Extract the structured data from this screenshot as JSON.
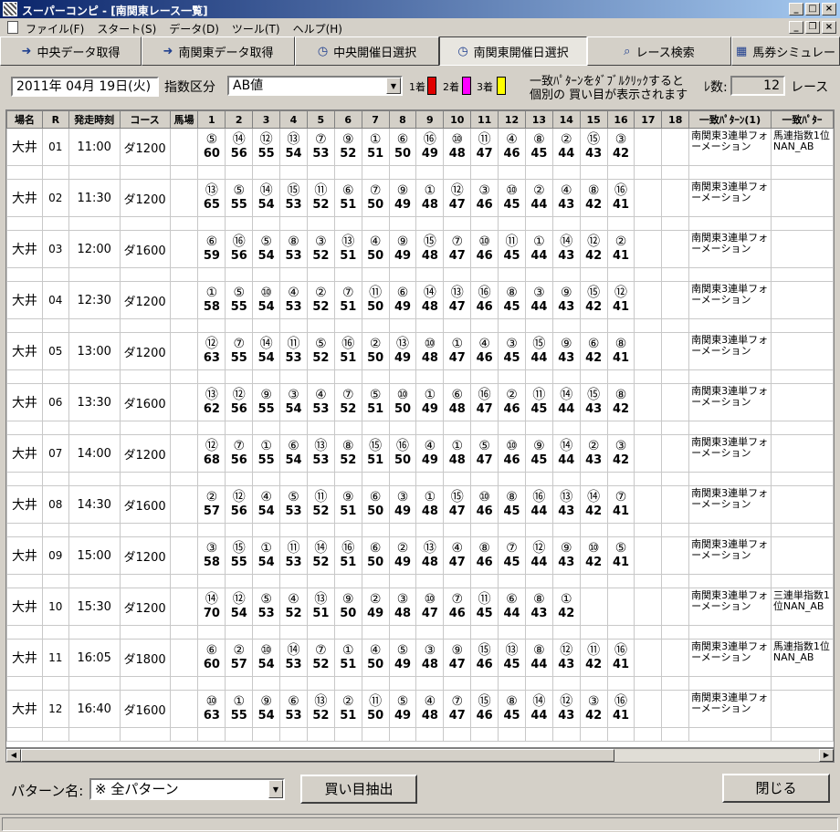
{
  "window": {
    "title": "スーパーコンピ - [南関東レース一覧]"
  },
  "menu": {
    "items": [
      "ファイル(F)",
      "スタート(S)",
      "データ(D)",
      "ツール(T)",
      "ヘルプ(H)"
    ]
  },
  "toolbar": {
    "buttons": [
      {
        "label": "中央データ取得",
        "icon": "arrow-icon"
      },
      {
        "label": "南関東データ取得",
        "icon": "arrow-icon"
      },
      {
        "label": "中央開催日選択",
        "icon": "clock-icon"
      },
      {
        "label": "南関東開催日選択",
        "icon": "clock-icon"
      },
      {
        "label": "レース検索",
        "icon": "magnifier-icon"
      },
      {
        "label": "馬券シミュレー",
        "icon": "table-icon"
      }
    ]
  },
  "filters": {
    "date": "2011年 04月 19日(火)",
    "index_label": "指数区分",
    "index_value": "AB値",
    "place1_label": "1着",
    "place2_label": "2着",
    "place3_label": "3着",
    "place1_color": "#e00000",
    "place2_color": "#ff00ff",
    "place3_color": "#ffff00",
    "hint_line1": "一致ﾊﾟﾀｰﾝをﾀﾞﾌﾞﾙｸﾘｯｸすると",
    "hint_line2": "個別の 買い目が表示されます",
    "count_label": "ﾚ数:",
    "count_value": "12",
    "count_unit": "レース"
  },
  "table": {
    "headers": [
      "場名",
      "R",
      "発走時刻",
      "コース",
      "馬場",
      "1",
      "2",
      "3",
      "4",
      "5",
      "6",
      "7",
      "8",
      "9",
      "10",
      "11",
      "12",
      "13",
      "14",
      "15",
      "16",
      "17",
      "18",
      "一致ﾊﾟﾀｰﾝ(1)",
      "一致ﾊﾟﾀｰ"
    ],
    "rows": [
      {
        "place": "大井",
        "r": "01",
        "time": "11:00",
        "course": "ダ1200",
        "baba": "",
        "horses": [
          "⑤",
          "⑭",
          "⑫",
          "⑬",
          "⑦",
          "⑨",
          "①",
          "⑥",
          "⑯",
          "⑩",
          "⑪",
          "④",
          "⑧",
          "②",
          "⑮",
          "③"
        ],
        "scores": [
          "60",
          "56",
          "55",
          "54",
          "53",
          "52",
          "51",
          "50",
          "49",
          "48",
          "47",
          "46",
          "45",
          "44",
          "43",
          "42"
        ],
        "pattern1": "南関東3連単フォーメーション",
        "pattern2": "馬連指数1位NAN_AB"
      },
      {
        "place": "大井",
        "r": "02",
        "time": "11:30",
        "course": "ダ1200",
        "baba": "",
        "horses": [
          "⑬",
          "⑤",
          "⑭",
          "⑮",
          "⑪",
          "⑥",
          "⑦",
          "⑨",
          "①",
          "⑫",
          "③",
          "⑩",
          "②",
          "④",
          "⑧",
          "⑯"
        ],
        "scores": [
          "65",
          "55",
          "54",
          "53",
          "52",
          "51",
          "50",
          "49",
          "48",
          "47",
          "46",
          "45",
          "44",
          "43",
          "42",
          "41"
        ],
        "pattern1": "南関東3連単フォーメーション",
        "pattern2": ""
      },
      {
        "place": "大井",
        "r": "03",
        "time": "12:00",
        "course": "ダ1600",
        "baba": "",
        "horses": [
          "⑥",
          "⑯",
          "⑤",
          "⑧",
          "③",
          "⑬",
          "④",
          "⑨",
          "⑮",
          "⑦",
          "⑩",
          "⑪",
          "①",
          "⑭",
          "⑫",
          "②"
        ],
        "scores": [
          "59",
          "56",
          "54",
          "53",
          "52",
          "51",
          "50",
          "49",
          "48",
          "47",
          "46",
          "45",
          "44",
          "43",
          "42",
          "41"
        ],
        "pattern1": "南関東3連単フォーメーション",
        "pattern2": ""
      },
      {
        "place": "大井",
        "r": "04",
        "time": "12:30",
        "course": "ダ1200",
        "baba": "",
        "horses": [
          "①",
          "⑤",
          "⑩",
          "④",
          "②",
          "⑦",
          "⑪",
          "⑥",
          "⑭",
          "⑬",
          "⑯",
          "⑧",
          "③",
          "⑨",
          "⑮",
          "⑫"
        ],
        "scores": [
          "58",
          "55",
          "54",
          "53",
          "52",
          "51",
          "50",
          "49",
          "48",
          "47",
          "46",
          "45",
          "44",
          "43",
          "42",
          "41"
        ],
        "pattern1": "南関東3連単フォーメーション",
        "pattern2": ""
      },
      {
        "place": "大井",
        "r": "05",
        "time": "13:00",
        "course": "ダ1200",
        "baba": "",
        "horses": [
          "⑫",
          "⑦",
          "⑭",
          "⑪",
          "⑤",
          "⑯",
          "②",
          "⑬",
          "⑩",
          "①",
          "④",
          "③",
          "⑮",
          "⑨",
          "⑥",
          "⑧"
        ],
        "scores": [
          "63",
          "55",
          "54",
          "53",
          "52",
          "51",
          "50",
          "49",
          "48",
          "47",
          "46",
          "45",
          "44",
          "43",
          "42",
          "41"
        ],
        "pattern1": "南関東3連単フォーメーション",
        "pattern2": ""
      },
      {
        "place": "大井",
        "r": "06",
        "time": "13:30",
        "course": "ダ1600",
        "baba": "",
        "horses": [
          "⑬",
          "⑫",
          "⑨",
          "③",
          "④",
          "⑦",
          "⑤",
          "⑩",
          "①",
          "⑥",
          "⑯",
          "②",
          "⑪",
          "⑭",
          "⑮",
          "⑧"
        ],
        "scores": [
          "62",
          "56",
          "55",
          "54",
          "53",
          "52",
          "51",
          "50",
          "49",
          "48",
          "47",
          "46",
          "45",
          "44",
          "43",
          "42"
        ],
        "pattern1": "南関東3連単フォーメーション",
        "pattern2": ""
      },
      {
        "place": "大井",
        "r": "07",
        "time": "14:00",
        "course": "ダ1200",
        "baba": "",
        "horses": [
          "⑫",
          "⑦",
          "①",
          "⑥",
          "⑬",
          "⑧",
          "⑮",
          "⑯",
          "④",
          "①",
          "⑤",
          "⑩",
          "⑨",
          "⑭",
          "②",
          "③"
        ],
        "scores": [
          "68",
          "56",
          "55",
          "54",
          "53",
          "52",
          "51",
          "50",
          "49",
          "48",
          "47",
          "46",
          "45",
          "44",
          "43",
          "42"
        ],
        "pattern1": "南関東3連単フォーメーション",
        "pattern2": ""
      },
      {
        "place": "大井",
        "r": "08",
        "time": "14:30",
        "course": "ダ1600",
        "baba": "",
        "horses": [
          "②",
          "⑫",
          "④",
          "⑤",
          "⑪",
          "⑨",
          "⑥",
          "③",
          "①",
          "⑮",
          "⑩",
          "⑧",
          "⑯",
          "⑬",
          "⑭",
          "⑦"
        ],
        "scores": [
          "57",
          "56",
          "54",
          "53",
          "52",
          "51",
          "50",
          "49",
          "48",
          "47",
          "46",
          "45",
          "44",
          "43",
          "42",
          "41"
        ],
        "pattern1": "南関東3連単フォーメーション",
        "pattern2": ""
      },
      {
        "place": "大井",
        "r": "09",
        "time": "15:00",
        "course": "ダ1200",
        "baba": "",
        "horses": [
          "③",
          "⑮",
          "①",
          "⑪",
          "⑭",
          "⑯",
          "⑥",
          "②",
          "⑬",
          "④",
          "⑧",
          "⑦",
          "⑫",
          "⑨",
          "⑩",
          "⑤"
        ],
        "scores": [
          "58",
          "55",
          "54",
          "53",
          "52",
          "51",
          "50",
          "49",
          "48",
          "47",
          "46",
          "45",
          "44",
          "43",
          "42",
          "41"
        ],
        "pattern1": "南関東3連単フォーメーション",
        "pattern2": ""
      },
      {
        "place": "大井",
        "r": "10",
        "time": "15:30",
        "course": "ダ1200",
        "baba": "",
        "horses": [
          "⑭",
          "⑫",
          "⑤",
          "④",
          "⑬",
          "⑨",
          "②",
          "③",
          "⑩",
          "⑦",
          "⑪",
          "⑥",
          "⑧",
          "①",
          "",
          ""
        ],
        "scores": [
          "70",
          "54",
          "53",
          "52",
          "51",
          "50",
          "49",
          "48",
          "47",
          "46",
          "45",
          "44",
          "43",
          "42",
          "",
          ""
        ],
        "pattern1": "南関東3連単フォーメーション",
        "pattern2": "三連単指数1位NAN_AB"
      },
      {
        "place": "大井",
        "r": "11",
        "time": "16:05",
        "course": "ダ1800",
        "baba": "",
        "horses": [
          "⑥",
          "②",
          "⑩",
          "⑭",
          "⑦",
          "①",
          "④",
          "⑤",
          "③",
          "⑨",
          "⑮",
          "⑬",
          "⑧",
          "⑫",
          "⑪",
          "⑯"
        ],
        "scores": [
          "60",
          "57",
          "54",
          "53",
          "52",
          "51",
          "50",
          "49",
          "48",
          "47",
          "46",
          "45",
          "44",
          "43",
          "42",
          "41"
        ],
        "pattern1": "南関東3連単フォーメーション",
        "pattern2": "馬連指数1位NAN_AB"
      },
      {
        "place": "大井",
        "r": "12",
        "time": "16:40",
        "course": "ダ1600",
        "baba": "",
        "horses": [
          "⑩",
          "①",
          "⑨",
          "⑥",
          "⑬",
          "②",
          "⑪",
          "⑤",
          "④",
          "⑦",
          "⑮",
          "⑧",
          "⑭",
          "⑫",
          "③",
          "⑯"
        ],
        "scores": [
          "63",
          "55",
          "54",
          "53",
          "52",
          "51",
          "50",
          "49",
          "48",
          "47",
          "46",
          "45",
          "44",
          "43",
          "42",
          "41"
        ],
        "pattern1": "南関東3連単フォーメーション",
        "pattern2": ""
      }
    ]
  },
  "bottom": {
    "pattern_label": "パターン名:",
    "pattern_value": "※ 全パターン",
    "extract_button": "買い目抽出",
    "close_button": "閉じる"
  }
}
